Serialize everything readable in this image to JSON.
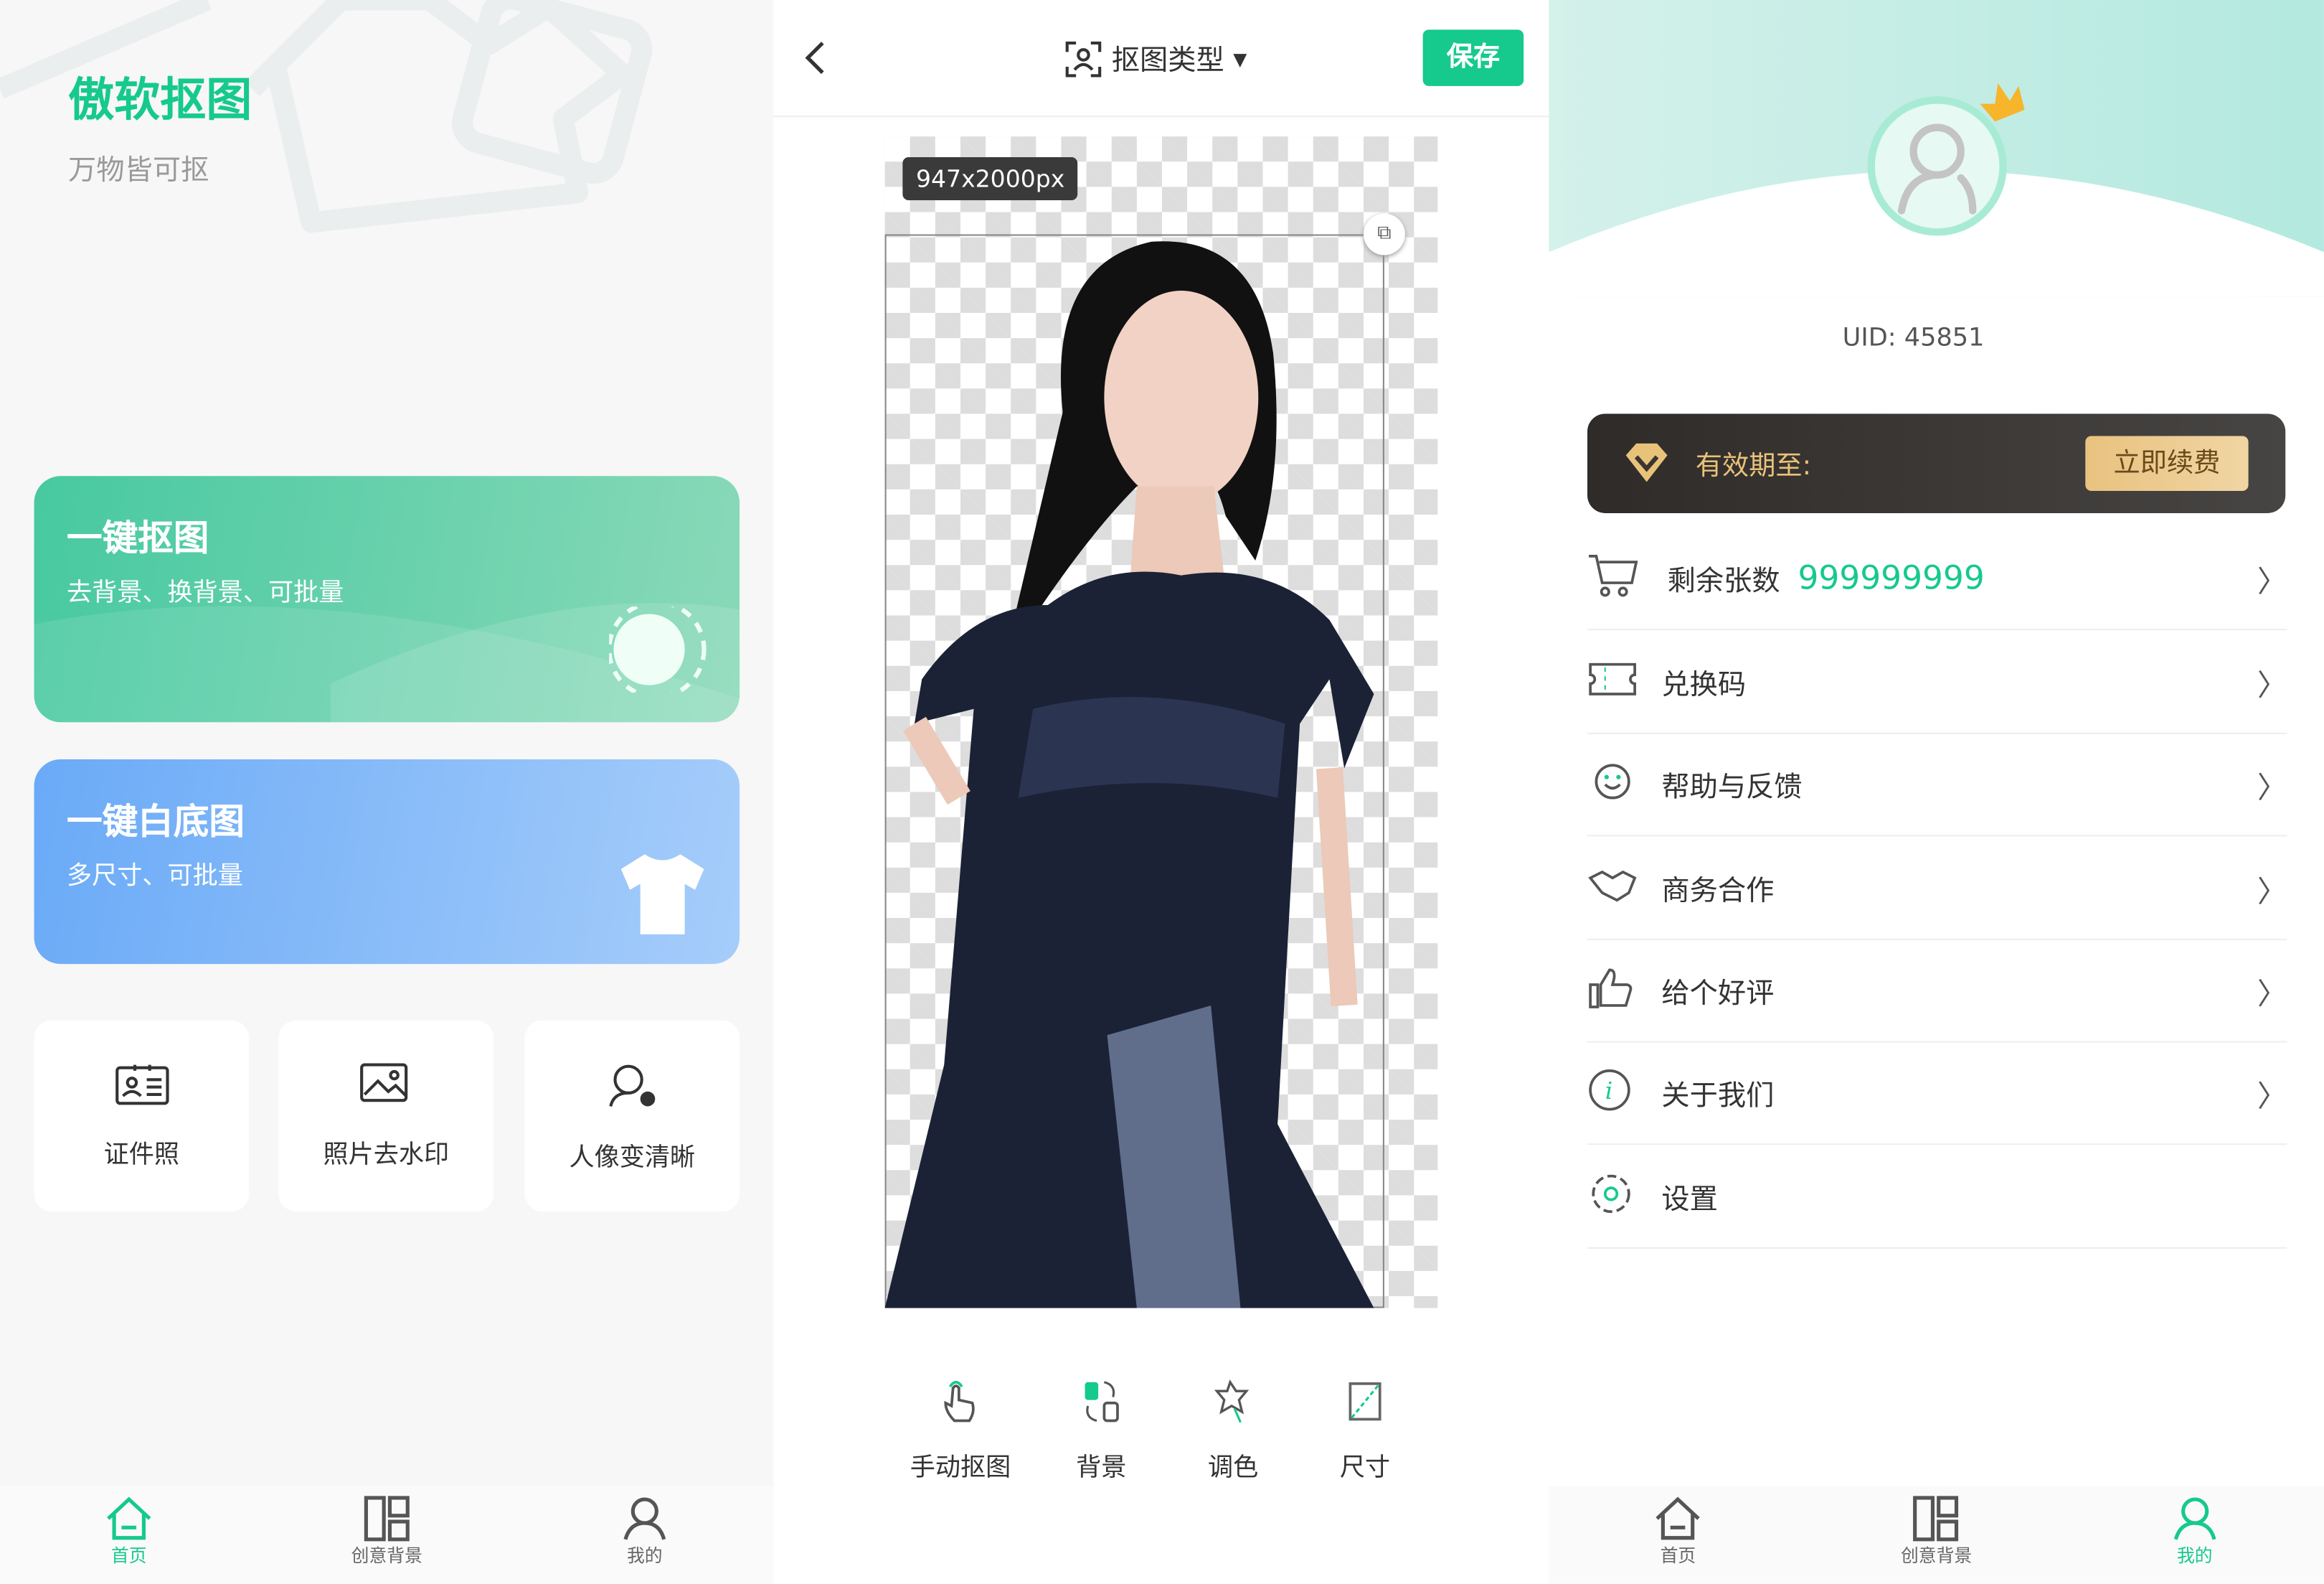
{
  "home": {
    "app_title": "傲软抠图",
    "slogan": "万物皆可抠",
    "cards": [
      {
        "title": "一键抠图",
        "desc": "去背景、换背景、可批量"
      },
      {
        "title": "一键白底图",
        "desc": "多尺寸、可批量"
      }
    ],
    "tiles": [
      "证件照",
      "照片去水印",
      "人像变清晰"
    ]
  },
  "nav": [
    "首页",
    "创意背景",
    "我的"
  ],
  "editor": {
    "type_label": "抠图类型",
    "save": "保存",
    "size_badge": "947x2000px",
    "tools": [
      "手动抠图",
      "背景",
      "调色",
      "尺寸"
    ]
  },
  "profile": {
    "uid": "UID: 45851",
    "vip_label": "有效期至:",
    "renew": "立即续费",
    "menu": [
      {
        "label": "剩余张数",
        "value": "999999999"
      },
      {
        "label": "兑换码"
      },
      {
        "label": "帮助与反馈"
      },
      {
        "label": "商务合作"
      },
      {
        "label": "给个好评"
      },
      {
        "label": "关于我们"
      },
      {
        "label": "设置"
      }
    ]
  },
  "colors": {
    "accent": "#16c98d",
    "gold": "#e9c27a",
    "dark": "#302d2b"
  }
}
